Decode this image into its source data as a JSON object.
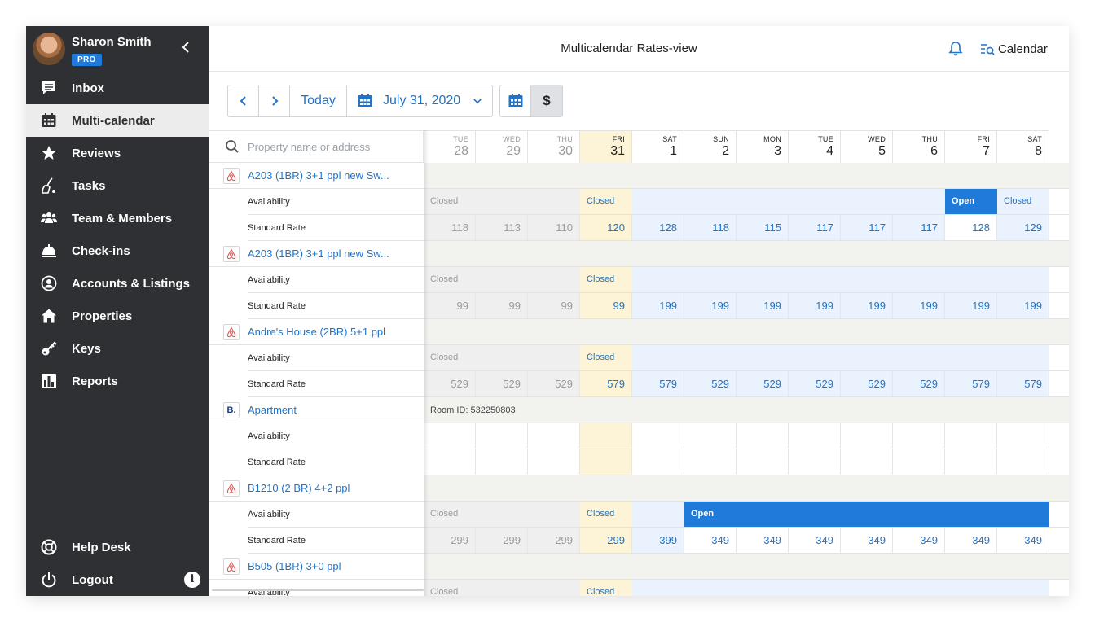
{
  "user": {
    "name": "Sharon Smith",
    "badge": "PRO"
  },
  "nav": [
    {
      "label": "Inbox",
      "icon": "inbox-icon"
    },
    {
      "label": "Multi-calendar",
      "icon": "calendar-icon",
      "active": true
    },
    {
      "label": "Reviews",
      "icon": "star-icon"
    },
    {
      "label": "Tasks",
      "icon": "broom-icon"
    },
    {
      "label": "Team & Members",
      "icon": "team-icon"
    },
    {
      "label": "Check-ins",
      "icon": "bell-desk-icon"
    },
    {
      "label": "Accounts & Listings",
      "icon": "account-icon"
    },
    {
      "label": "Properties",
      "icon": "home-icon"
    },
    {
      "label": "Keys",
      "icon": "key-icon"
    },
    {
      "label": "Reports",
      "icon": "reports-icon"
    }
  ],
  "footer_nav": [
    {
      "label": "Help Desk",
      "icon": "lifebuoy-icon"
    },
    {
      "label": "Logout",
      "icon": "power-icon"
    }
  ],
  "info_glyph": "i",
  "header": {
    "title": "Multicalendar Rates-view",
    "calendar_link": "Calendar"
  },
  "toolbar": {
    "prev": "‹",
    "next": "›",
    "today": "Today",
    "date": "July 31, 2020",
    "dollar": "$"
  },
  "search": {
    "placeholder": "Property name or address"
  },
  "days": [
    {
      "name": "TUE",
      "num": "28",
      "state": "past"
    },
    {
      "name": "WED",
      "num": "29",
      "state": "past"
    },
    {
      "name": "THU",
      "num": "30",
      "state": "past"
    },
    {
      "name": "FRI",
      "num": "31",
      "state": "today"
    },
    {
      "name": "SAT",
      "num": "1",
      "state": "future"
    },
    {
      "name": "SUN",
      "num": "2",
      "state": "future"
    },
    {
      "name": "MON",
      "num": "3",
      "state": "future"
    },
    {
      "name": "TUE",
      "num": "4",
      "state": "future"
    },
    {
      "name": "WED",
      "num": "5",
      "state": "future"
    },
    {
      "name": "THU",
      "num": "6",
      "state": "future"
    },
    {
      "name": "FRI",
      "num": "7",
      "state": "future"
    },
    {
      "name": "SAT",
      "num": "8",
      "state": "future"
    }
  ],
  "labels": {
    "availability": "Availability",
    "standard_rate": "Standard Rate"
  },
  "properties": [
    {
      "name": "A203 (1BR) 3+1 ppl new Sw...",
      "channel": "airbnb",
      "availability": [
        {
          "from": 0,
          "to": 3,
          "status": "Closed",
          "type": "closed-past"
        },
        {
          "from": 3,
          "to": 4,
          "status": "Closed",
          "type": "closed-today"
        },
        {
          "from": 4,
          "to": 10,
          "status": "",
          "type": "closed-fut"
        },
        {
          "from": 10,
          "to": 11,
          "status": "Open",
          "type": "open"
        },
        {
          "from": 11,
          "to": 12,
          "status": "Closed",
          "type": "closed-fut"
        }
      ],
      "rates": [
        "118",
        "113",
        "110",
        "120",
        "128",
        "118",
        "115",
        "117",
        "117",
        "117",
        "128",
        "129"
      ],
      "white_cols": [
        10
      ]
    },
    {
      "name": "A203 (1BR) 3+1 ppl new Sw...",
      "channel": "airbnb",
      "availability": [
        {
          "from": 0,
          "to": 3,
          "status": "Closed",
          "type": "closed-past"
        },
        {
          "from": 3,
          "to": 4,
          "status": "Closed",
          "type": "closed-today"
        },
        {
          "from": 4,
          "to": 12,
          "status": "",
          "type": "closed-fut"
        }
      ],
      "rates": [
        "99",
        "99",
        "99",
        "99",
        "199",
        "199",
        "199",
        "199",
        "199",
        "199",
        "199",
        "199"
      ],
      "white_cols": []
    },
    {
      "name": "Andre's House (2BR) 5+1 ppl",
      "channel": "airbnb",
      "availability": [
        {
          "from": 0,
          "to": 3,
          "status": "Closed",
          "type": "closed-past"
        },
        {
          "from": 3,
          "to": 4,
          "status": "Closed",
          "type": "closed-today"
        },
        {
          "from": 4,
          "to": 12,
          "status": "",
          "type": "closed-fut"
        }
      ],
      "rates": [
        "529",
        "529",
        "529",
        "579",
        "579",
        "529",
        "529",
        "529",
        "529",
        "529",
        "579",
        "579"
      ],
      "white_cols": []
    },
    {
      "name": "Apartment",
      "channel": "booking",
      "channel_letter": "B.",
      "room_id": "Room ID: 532250803",
      "availability": [],
      "rates": [
        "",
        "",
        "",
        "",
        "",
        "",
        "",
        "",
        "",
        "",
        "",
        ""
      ],
      "empty": true,
      "white_cols": []
    },
    {
      "name": "B1210 (2 BR) 4+2 ppl",
      "channel": "airbnb",
      "availability": [
        {
          "from": 0,
          "to": 3,
          "status": "Closed",
          "type": "closed-past"
        },
        {
          "from": 3,
          "to": 4,
          "status": "Closed",
          "type": "closed-today"
        },
        {
          "from": 4,
          "to": 5,
          "status": "",
          "type": "closed-fut"
        },
        {
          "from": 5,
          "to": 12,
          "status": "Open",
          "type": "open"
        }
      ],
      "rates": [
        "299",
        "299",
        "299",
        "299",
        "399",
        "349",
        "349",
        "349",
        "349",
        "349",
        "349",
        "349"
      ],
      "white_cols": [
        5,
        6,
        7,
        8,
        9,
        10,
        11
      ]
    },
    {
      "name": "B505 (1BR) 3+0 ppl",
      "channel": "airbnb",
      "availability": [
        {
          "from": 0,
          "to": 3,
          "status": "Closed",
          "type": "closed-past"
        },
        {
          "from": 3,
          "to": 4,
          "status": "Closed",
          "type": "closed-today"
        },
        {
          "from": 4,
          "to": 12,
          "status": "",
          "type": "closed-fut"
        }
      ],
      "rates": [],
      "white_cols": []
    }
  ],
  "colors": {
    "sidebar": "#2f3033",
    "accent": "#1f7ad9",
    "today": "#fdf3d6",
    "future_bg": "#eaf3fd",
    "past_bg": "#efefef"
  }
}
